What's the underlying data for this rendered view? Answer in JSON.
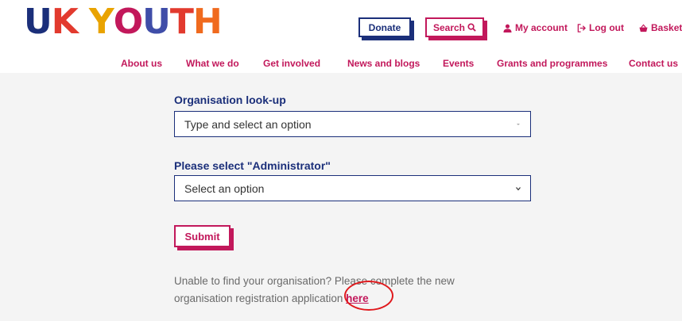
{
  "brand": {
    "logo_parts": [
      "U",
      "K",
      "Y",
      "O",
      "U",
      "T",
      "H"
    ]
  },
  "header": {
    "donate_label": "Donate",
    "search_label": "Search",
    "account_label": "My account",
    "logout_label": "Log out",
    "basket_label": "Basket"
  },
  "nav": {
    "items": [
      "About us",
      "What we do",
      "Get involved",
      "News and blogs",
      "Events",
      "Grants and programmes",
      "Contact us"
    ]
  },
  "form": {
    "org_label": "Organisation look-up",
    "org_value": "Type and select an option",
    "role_label": "Please select \"Administrator\"",
    "role_value": "Select an option",
    "submit_label": "Submit"
  },
  "help": {
    "text": "Unable to find your organisation? Please complete the new organisation registration application ",
    "link": "here"
  },
  "colors": {
    "brand_navy": "#1b2f7a",
    "brand_pink": "#c2185b",
    "annotation_red": "#e0191d"
  }
}
